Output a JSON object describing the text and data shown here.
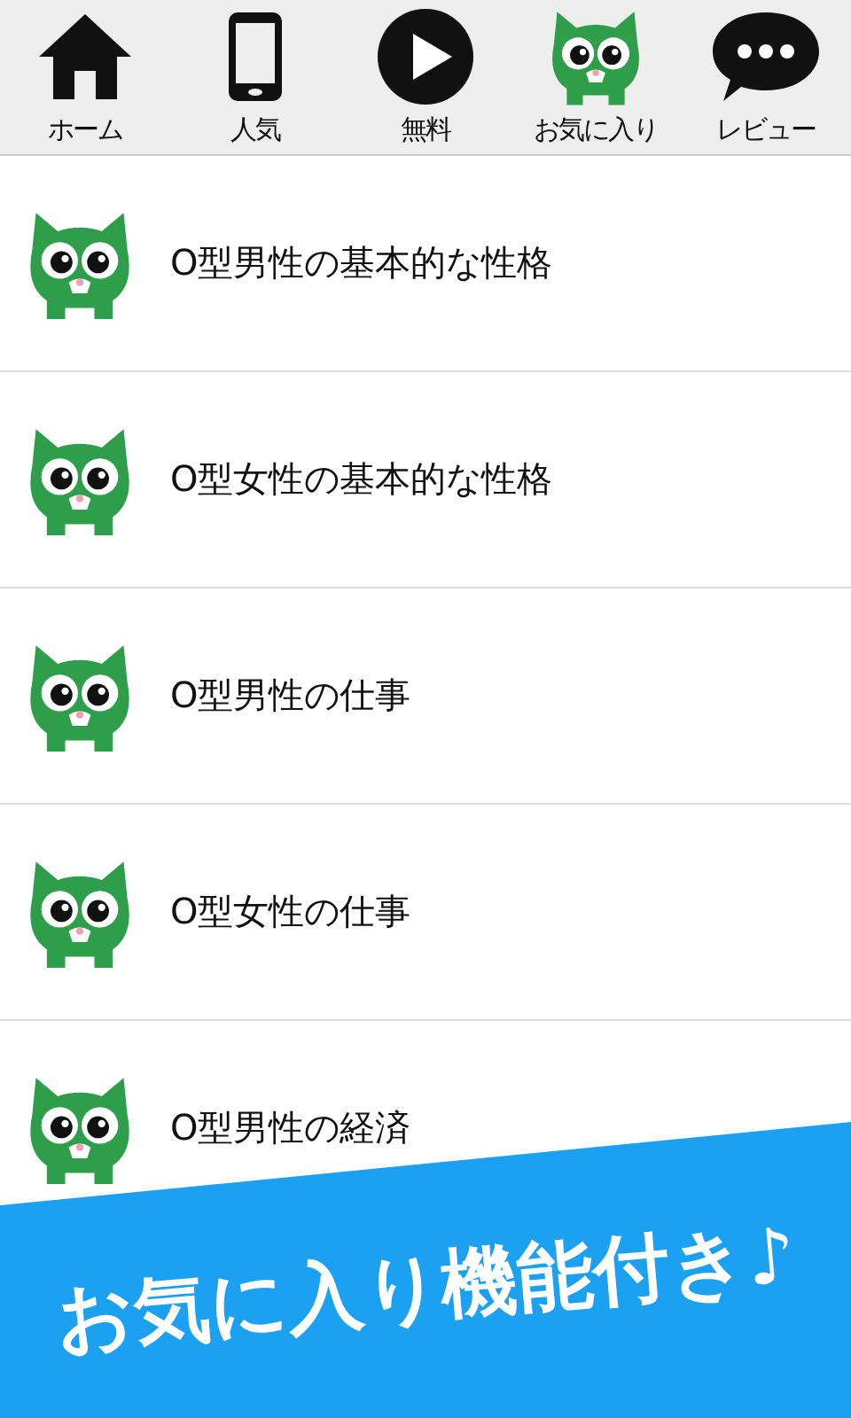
{
  "tabs": [
    {
      "label": "ホーム",
      "kind": "home"
    },
    {
      "label": "人気",
      "kind": "phone"
    },
    {
      "label": "無料",
      "kind": "play"
    },
    {
      "label": "お気に入り",
      "kind": "owl"
    },
    {
      "label": "レビュー",
      "kind": "chat"
    }
  ],
  "items": [
    {
      "title": "O型男性の基本的な性格"
    },
    {
      "title": "O型女性の基本的な性格"
    },
    {
      "title": "O型男性の仕事"
    },
    {
      "title": "O型女性の仕事"
    },
    {
      "title": "O型男性の経済"
    }
  ],
  "banner": {
    "text": "お気に入り機能付き♪"
  }
}
